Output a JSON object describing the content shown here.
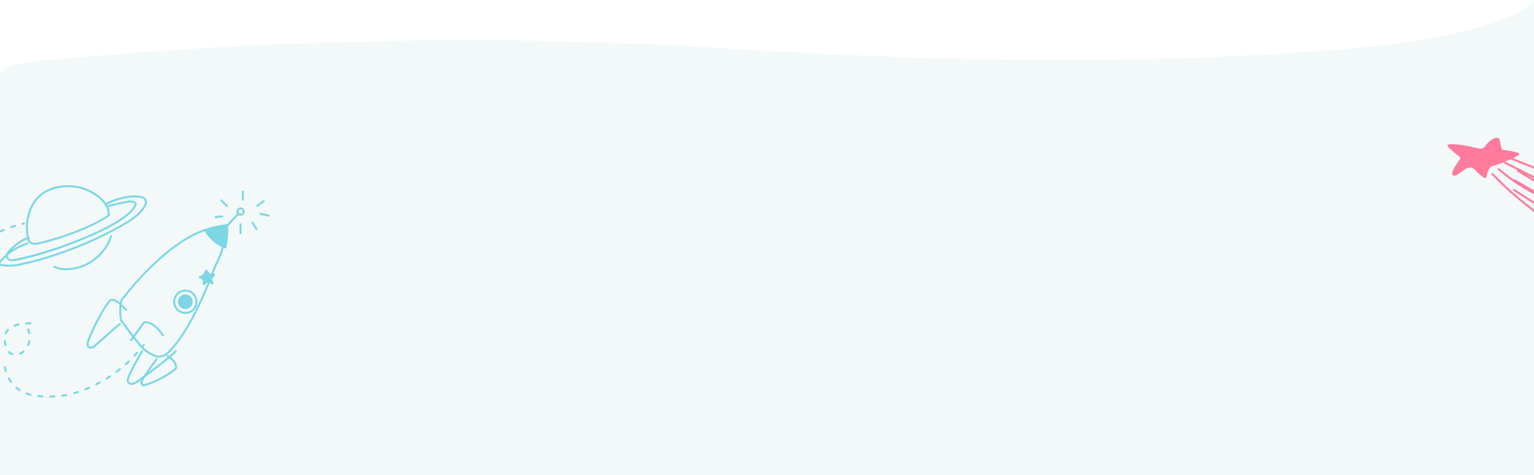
{
  "background": {
    "page_color": "#ffffff",
    "wave_fill": "#f3f9f9"
  },
  "colors": {
    "doodle_stroke": "#7dd6e4",
    "doodle_fill": "#7dd6e4",
    "shooting_star": "#ff7a9c"
  },
  "illustrations": {
    "planet": {
      "icon": "ringed-planet-icon"
    },
    "rocket": {
      "icon": "rocket-icon"
    },
    "sparkle": {
      "icon": "sparkle-icon"
    },
    "flight_path": {
      "icon": "dashed-trail-icon"
    },
    "shooting_star": {
      "icon": "shooting-star-icon"
    }
  }
}
